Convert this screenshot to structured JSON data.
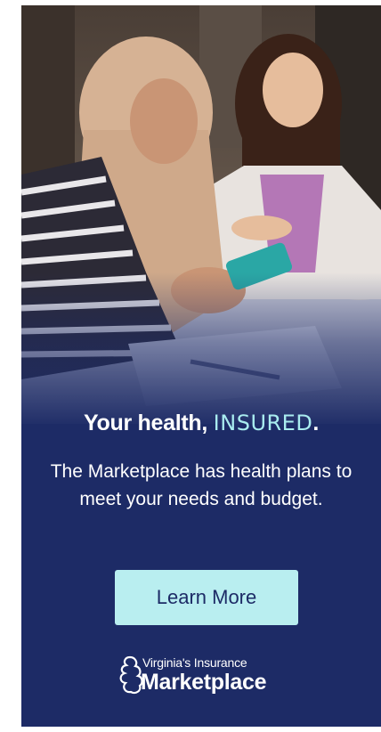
{
  "ad": {
    "headline_prefix": "Your health,",
    "headline_accent": "INSURED",
    "headline_suffix": ".",
    "body": "The Marketplace has health plans to meet your needs and budget.",
    "cta_label": "Learn More",
    "logo_small": "Virginia's Insurance",
    "logo_big": "Marketplace"
  },
  "colors": {
    "background": "#1d2b66",
    "accent": "#a9ecef",
    "button": "#b9eef0",
    "text": "#ffffff"
  }
}
